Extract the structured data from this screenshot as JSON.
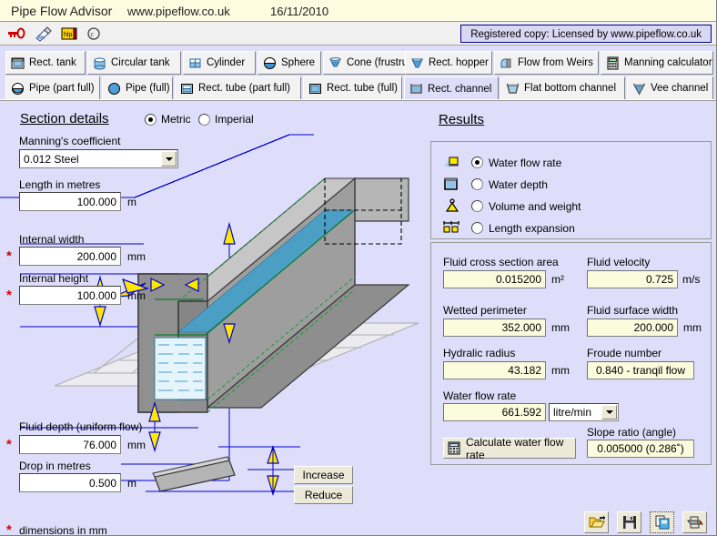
{
  "titlebar": {
    "app_name": "Pipe Flow Advisor",
    "website": "www.pipeflow.co.uk",
    "date": "16/11/2010"
  },
  "toolbar": {
    "icons": [
      "key-icon",
      "notes-icon",
      "help-icon",
      "copyright-icon"
    ],
    "license_text": "Registered copy: Licensed by www.pipeflow.co.uk"
  },
  "tabs": {
    "row1": [
      {
        "label": "Rect. tank",
        "icon": "rect-tank-icon"
      },
      {
        "label": "Circular tank",
        "icon": "circular-tank-icon"
      },
      {
        "label": "Cylinder",
        "icon": "cylinder-icon"
      },
      {
        "label": "Sphere",
        "icon": "sphere-icon"
      },
      {
        "label": "Cone (frustrum)",
        "icon": "cone-icon"
      },
      {
        "label": "Rect. hopper",
        "icon": "rect-hopper-icon"
      },
      {
        "label": "Flow from Weirs",
        "icon": "weir-icon"
      },
      {
        "label": "Manning calculator",
        "icon": "calculator-icon"
      }
    ],
    "row2": [
      {
        "label": "Pipe (part full)",
        "icon": "pipe-part-full-icon"
      },
      {
        "label": "Pipe (full)",
        "icon": "pipe-full-icon"
      },
      {
        "label": "Rect. tube (part full)",
        "icon": "rect-tube-part-icon"
      },
      {
        "label": "Rect. tube (full)",
        "icon": "rect-tube-full-icon"
      },
      {
        "label": "Rect. channel",
        "icon": "rect-channel-icon"
      },
      {
        "label": "Flat bottom channel",
        "icon": "flat-bottom-channel-icon"
      },
      {
        "label": "Vee channel",
        "icon": "vee-channel-icon"
      }
    ],
    "active": "Rect. channel"
  },
  "section": {
    "title": "Section details",
    "units": {
      "metric": "Metric",
      "imperial": "Imperial",
      "selected": "Metric"
    },
    "manning_label": "Manning's coefficient",
    "manning_value": "0.012  Steel",
    "length_label": "Length  in metres",
    "length_value": "100.000",
    "length_unit": "m",
    "width_label": "Internal width",
    "width_value": "200.000",
    "width_unit": "mm",
    "height_label": "Internal height",
    "height_value": "100.000",
    "height_unit": "mm",
    "depth_label": "Fluid depth (uniform flow)",
    "depth_value": "76.000",
    "depth_unit": "mm",
    "drop_label": "Drop  in metres",
    "drop_value": "0.500",
    "drop_unit": "m",
    "increase_label": "Increase",
    "reduce_label": "Reduce",
    "footnote": "dimensions in mm",
    "required_marker": "*"
  },
  "results": {
    "title": "Results",
    "modes": [
      {
        "label": "Water flow rate",
        "icon": "flow-rate-icon",
        "selected": true
      },
      {
        "label": "Water depth",
        "icon": "water-depth-icon",
        "selected": false
      },
      {
        "label": "Volume and weight",
        "icon": "volume-weight-icon",
        "selected": false
      },
      {
        "label": "Length expansion",
        "icon": "length-expansion-icon",
        "selected": false
      }
    ],
    "fields": [
      {
        "label": "Fluid cross section area",
        "value": "0.015200",
        "unit": "m²"
      },
      {
        "label": "Fluid velocity",
        "value": "0.725",
        "unit": "m/s"
      },
      {
        "label": "Wetted perimeter",
        "value": "352.000",
        "unit": "mm"
      },
      {
        "label": "Fluid surface width",
        "value": "200.000",
        "unit": "mm"
      },
      {
        "label": "Hydralic radius",
        "value": "43.182",
        "unit": "mm"
      },
      {
        "label": "Froude number",
        "value": "0.840 - tranqil flow",
        "unit": ""
      }
    ],
    "flow_rate_label": "Water flow rate",
    "flow_rate_value": "661.592",
    "flow_rate_units_selected": "litre/min",
    "calc_button_label": "Calculate water flow rate",
    "slope_label": "Slope ratio (angle)",
    "slope_value": "0.005000 (0.286˚)"
  },
  "footer_icons": [
    {
      "name": "open-icon"
    },
    {
      "name": "save-icon"
    },
    {
      "name": "copy-icon"
    },
    {
      "name": "print-icon"
    }
  ],
  "colors": {
    "background": "#dedefa",
    "titlebar": "#fdfbe0",
    "result_field": "#fbfbdd",
    "dimension_line": "#0000cc",
    "arrow_fill": "#ffe800",
    "water": "#4b9fc4",
    "required_star": "#e00000"
  }
}
